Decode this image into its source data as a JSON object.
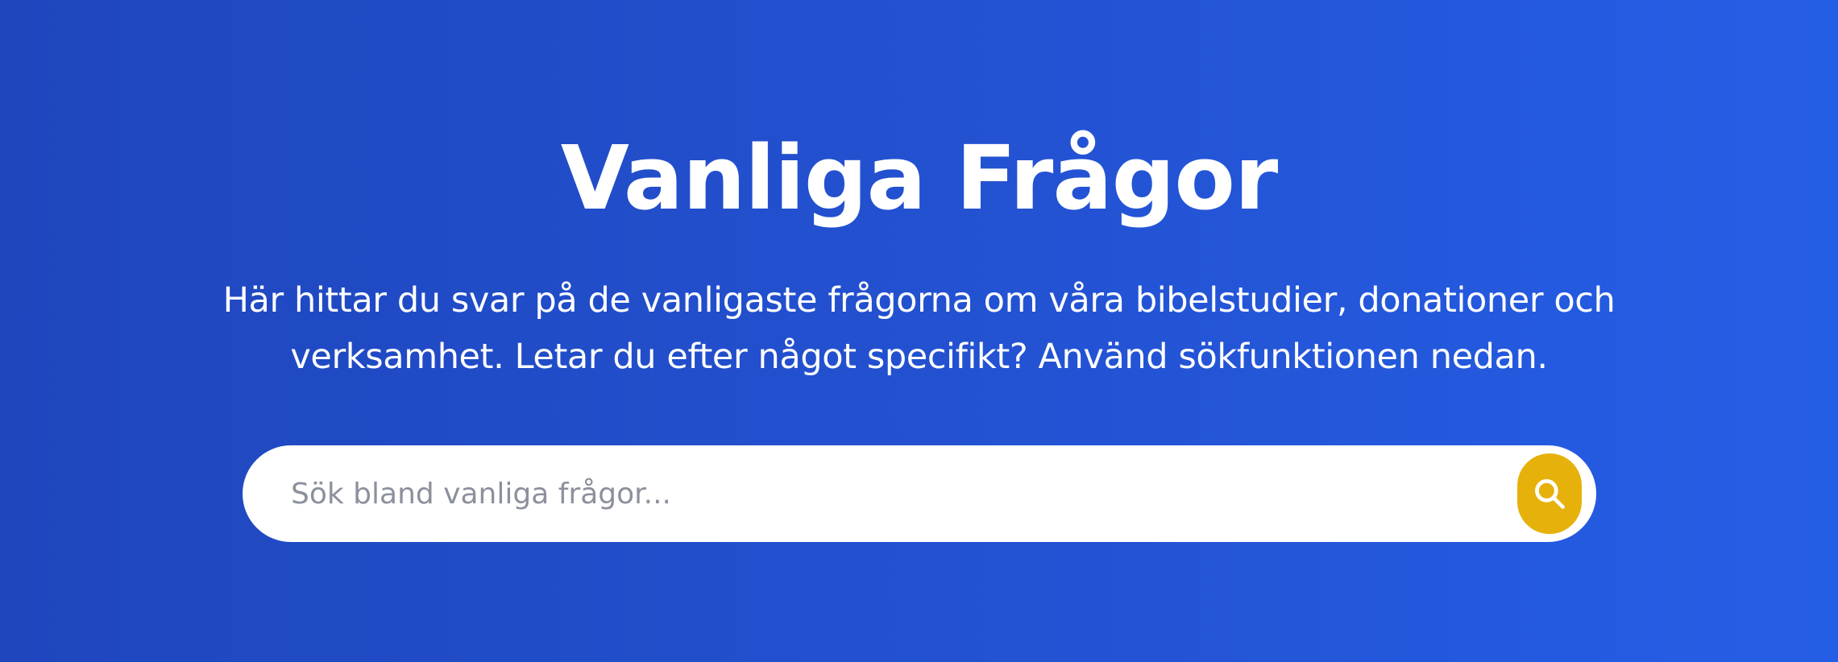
{
  "hero": {
    "title": "Vanliga Frågor",
    "subtitle": "Här hittar du svar på de vanligaste frågorna om våra bibelstudier, donationer och verksamhet. Letar du efter något specifikt? Använd sökfunktionen nedan."
  },
  "search": {
    "placeholder": "Sök bland vanliga frågor...",
    "value": "",
    "button_icon": "search-icon"
  },
  "colors": {
    "background_start": "#1f46bd",
    "background_end": "#255ee6",
    "accent": "#e6b10a",
    "text": "#ffffff"
  }
}
